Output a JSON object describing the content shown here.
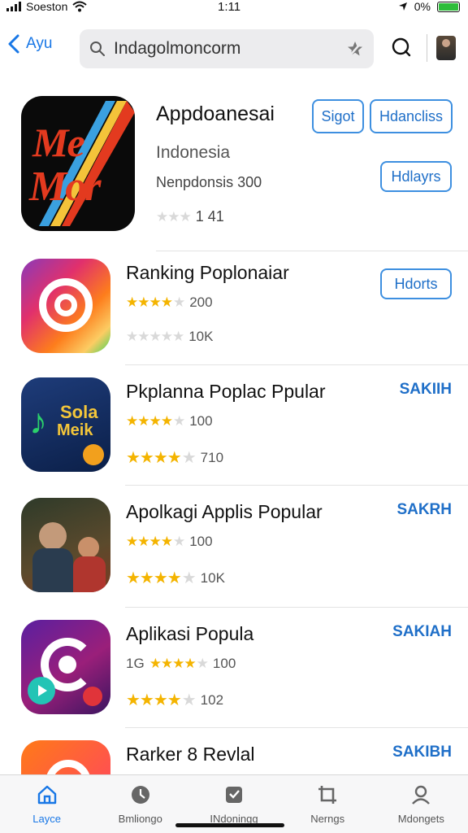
{
  "status": {
    "carrier": "Soeston",
    "time": "1:11",
    "battery": "0%"
  },
  "nav": {
    "back_label": "Ayu",
    "search_value": "Indagolmoncorm"
  },
  "featured": {
    "icon_line1": "Me",
    "icon_line2": "Mor",
    "title": "Appdoanesai",
    "subtitle": "Indonesia",
    "meta": "Nenpdonsis 300",
    "rating_count": "1 41",
    "btn_primary": "Sigot",
    "btn_secondary": "Hdancliss",
    "btn_third": "Hdlayrs"
  },
  "apps": [
    {
      "title": "Ranking  Poplonaiar",
      "r1_prefix": "",
      "r1_count": "200",
      "r2_count": "10K",
      "action": "Hdorts",
      "icon_text": ""
    },
    {
      "title": "Pkplanna Poplac Ppular",
      "r1_prefix": "",
      "r1_count": "100",
      "r2_count": "710",
      "action": "SAKIIH",
      "icon_text": "Sola",
      "icon_text2": "Meik"
    },
    {
      "title": "Apolkagi Applis Popular",
      "r1_prefix": "",
      "r1_count": "100",
      "r2_count": "10K",
      "action": "SAKRH",
      "icon_text": ""
    },
    {
      "title": "Aplikasi Popula",
      "r1_prefix": "1G",
      "r1_count": "100",
      "r2_count": "102",
      "action": "SAKIAH",
      "icon_text": ""
    },
    {
      "title": "Rarker 8 Revlal",
      "r1_prefix": "",
      "r1_count": "",
      "r2_count": "",
      "action": "SAKIBH",
      "icon_text": ""
    }
  ],
  "tabs": [
    {
      "label": "Layce",
      "icon": "home-icon",
      "active": true
    },
    {
      "label": "Bmliongo",
      "icon": "clock-icon",
      "active": false
    },
    {
      "label": "INdoningg",
      "icon": "apps-icon",
      "active": false
    },
    {
      "label": "Nerngs",
      "icon": "crop-icon",
      "active": false
    },
    {
      "label": "Mdongets",
      "icon": "profile-icon",
      "active": false
    }
  ],
  "colors": {
    "accent": "#1877e6",
    "star": "#f4b400",
    "star_off": "#d9d9d9"
  }
}
